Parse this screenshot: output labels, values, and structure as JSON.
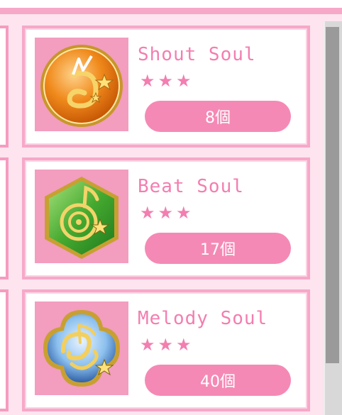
{
  "items": [
    {
      "name": "Shout Soul",
      "stars": "★★★",
      "count": "8個",
      "icon": "shout-soul-medal-icon",
      "icon_color": "#ef7c16"
    },
    {
      "name": "Beat Soul",
      "stars": "★★★",
      "count": "17個",
      "icon": "beat-soul-medal-icon",
      "icon_color": "#3ea82e"
    },
    {
      "name": "Melody Soul",
      "stars": "★★★",
      "count": "40個",
      "icon": "melody-soul-medal-icon",
      "icon_color": "#2d7fd0"
    }
  ],
  "colors": {
    "accent": "#f37eb0",
    "pill": "#f589b5",
    "card_border": "#f7a8c8",
    "background": "#fde4ee",
    "scrollbar_thumb": "#9a9a9a"
  }
}
